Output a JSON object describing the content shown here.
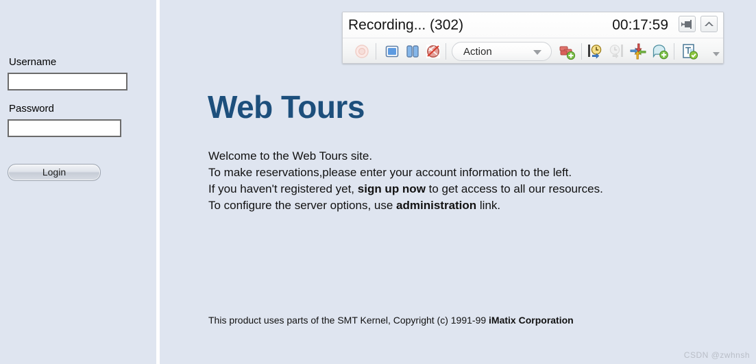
{
  "login": {
    "username_label": "Username",
    "password_label": "Password",
    "username_value": "",
    "password_value": "",
    "username_placeholder": "",
    "password_placeholder": "",
    "login_button": "Login"
  },
  "content": {
    "title": "Web Tours",
    "welcome_line_1": "Welcome to the Web Tours site.",
    "welcome_line_2": "To make reservations,please enter your account information to the left.",
    "welcome_line_3_a": "If you haven't registered yet, ",
    "welcome_line_3_link": "sign up now",
    "welcome_line_3_b": " to get access to all our resources.",
    "welcome_line_4_a": "To configure the server options, use ",
    "welcome_line_4_link": "administration",
    "welcome_line_4_b": " link.",
    "footer_a": "This product uses parts of the SMT Kernel, Copyright (c) 1991-99 ",
    "footer_b": "iMatix Corporation"
  },
  "watermark": "CSDN @zwhnsh",
  "recorder": {
    "title": "Recording... (302)",
    "timer": "00:17:59",
    "titlebar_buttons": [
      {
        "name": "dock-button",
        "icon": "dock-icon"
      },
      {
        "name": "collapse-button",
        "icon": "chevron-up-icon"
      }
    ],
    "action_combo": {
      "label": "Action",
      "options": [
        "Action"
      ]
    },
    "tools": [
      {
        "name": "record-button",
        "icon": "record-icon",
        "disabled": true
      },
      {
        "name": "stop-button",
        "icon": "stop-square-icon",
        "disabled": false
      },
      {
        "name": "pause-button",
        "icon": "pause-bars-icon",
        "disabled": false
      },
      {
        "name": "cancel-button",
        "icon": "no-entry-icon",
        "disabled": false
      },
      {
        "name": "insert-step-button",
        "icon": "steps-plus-icon",
        "disabled": false
      },
      {
        "name": "insert-start-transaction-button",
        "icon": "transaction-start-icon",
        "disabled": false
      },
      {
        "name": "insert-end-transaction-button",
        "icon": "transaction-end-icon",
        "disabled": true
      },
      {
        "name": "insert-rendezvous-button",
        "icon": "rendezvous-arrows-icon",
        "disabled": false
      },
      {
        "name": "insert-comment-button",
        "icon": "comment-plus-icon",
        "disabled": false
      },
      {
        "name": "insert-text-checkpoint-button",
        "icon": "text-checkpoint-icon",
        "disabled": false
      }
    ]
  },
  "colors": {
    "panel_bg": "#dfe5f0",
    "title_blue": "#1d4f7c",
    "toolbar_bg": "#f7f7f7",
    "watermark": "#b9bec7"
  }
}
